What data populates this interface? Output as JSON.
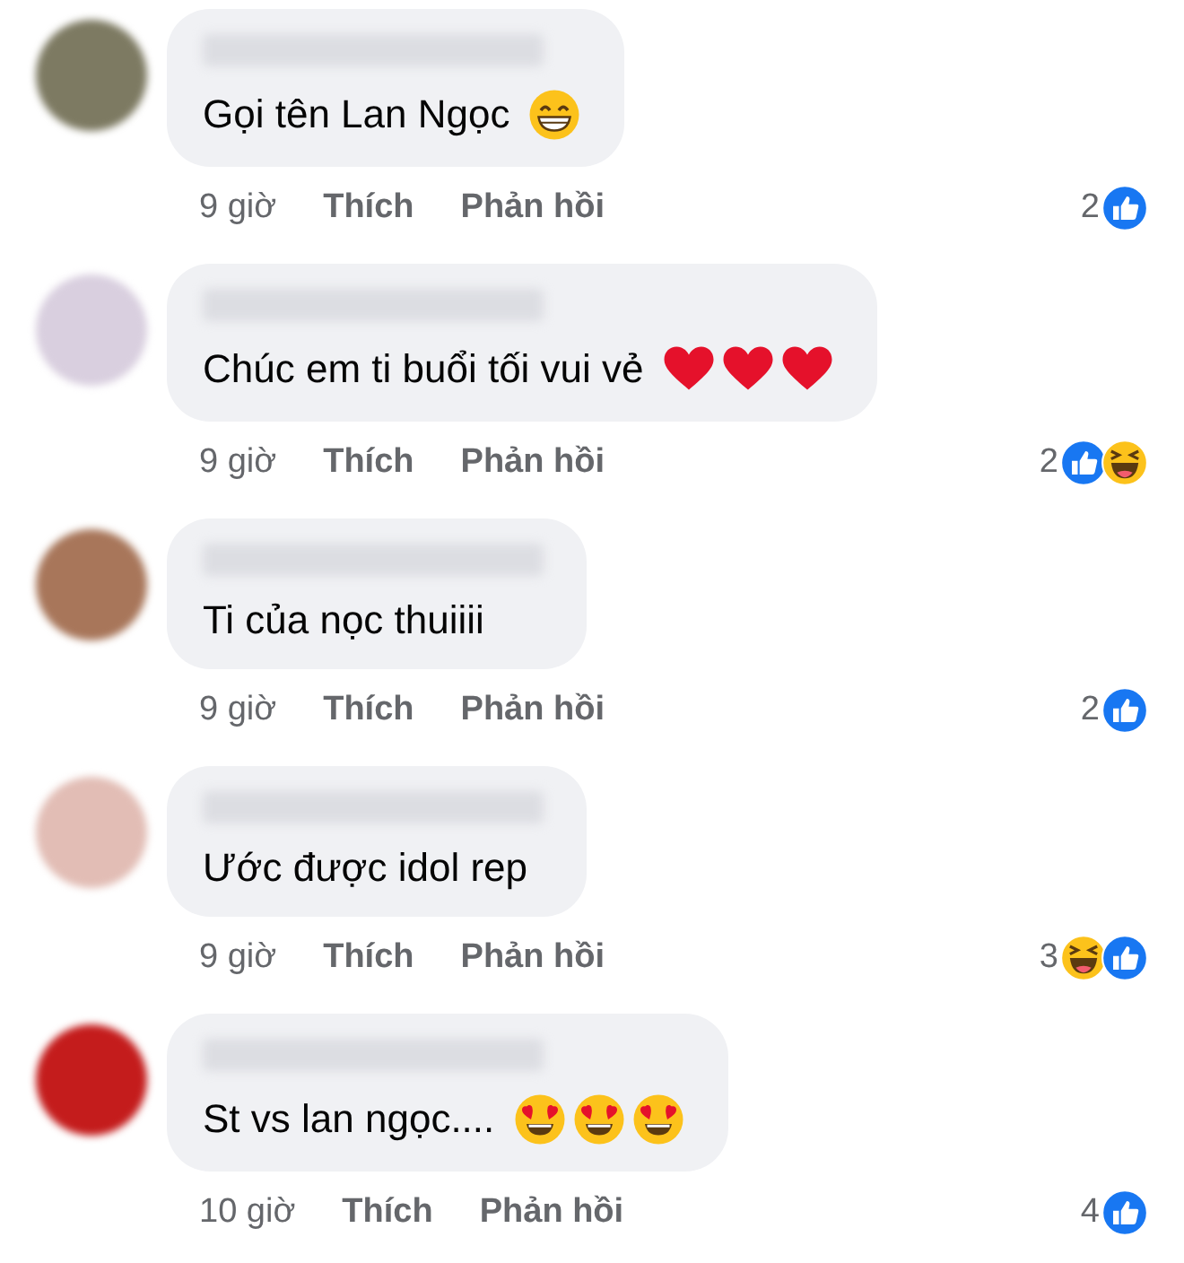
{
  "comments": [
    {
      "avatar": {
        "color": "#7d7a62"
      },
      "text": "Gọi tên Lan Ngọc",
      "emojis": [
        {
          "kind": "grin"
        }
      ],
      "time": "9 giờ",
      "like": "Thích",
      "reply": "Phản hồi",
      "reaction_count": "2",
      "reactions": [
        {
          "kind": "like"
        }
      ]
    },
    {
      "avatar": {
        "color": "#d9cfdf"
      },
      "text": "Chúc em ti buổi tối vui vẻ",
      "emojis": [
        {
          "kind": "heart"
        },
        {
          "kind": "heart"
        },
        {
          "kind": "heart"
        }
      ],
      "time": "9 giờ",
      "like": "Thích",
      "reply": "Phản hồi",
      "reaction_count": "2",
      "reactions": [
        {
          "kind": "like"
        },
        {
          "kind": "haha"
        }
      ]
    },
    {
      "avatar": {
        "color": "#a8765a"
      },
      "text": "Ti của nọc thuiiii",
      "time": "9 giờ",
      "like": "Thích",
      "reply": "Phản hồi",
      "reaction_count": "2",
      "reactions": [
        {
          "kind": "like"
        }
      ]
    },
    {
      "avatar": {
        "color": "#e2bdb5"
      },
      "text": "Ước được idol rep",
      "time": "9 giờ",
      "like": "Thích",
      "reply": "Phản hồi",
      "reaction_count": "3",
      "reactions": [
        {
          "kind": "haha"
        },
        {
          "kind": "like"
        }
      ]
    },
    {
      "avatar": {
        "color": "#c41c1c"
      },
      "text": "St vs lan ngọc....",
      "emojis": [
        {
          "kind": "heart_eyes"
        },
        {
          "kind": "heart_eyes"
        },
        {
          "kind": "heart_eyes"
        }
      ],
      "time": "10 giờ",
      "like": "Thích",
      "reply": "Phản hồi",
      "reaction_count": "4",
      "reactions": [
        {
          "kind": "like"
        }
      ]
    }
  ]
}
